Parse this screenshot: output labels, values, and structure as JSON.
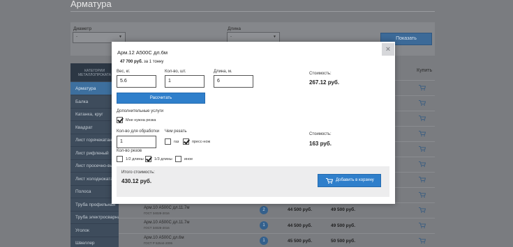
{
  "page": {
    "title": "Арматура"
  },
  "filters": {
    "diameter_label": "Диаметр",
    "diameter_value": "-",
    "length_label": "Длина",
    "length_value": "-",
    "show_button": "Показать"
  },
  "table": {
    "buy_header": "Купить"
  },
  "sidebar": {
    "header": "КАТЕГОРИИ МЕТАЛЛОПРОКАТА",
    "items": [
      {
        "label": "Арматура"
      },
      {
        "label": "Балка"
      },
      {
        "label": "Катанка, круг"
      },
      {
        "label": "Квадрат"
      },
      {
        "label": "Лист горячекатаный"
      },
      {
        "label": "Лист рифленый"
      },
      {
        "label": "Лист просечно-вытяжной"
      },
      {
        "label": "Лист холоднокатаный"
      },
      {
        "label": "Полоса"
      },
      {
        "label": "Труба профильная"
      },
      {
        "label": "Труба электросварная"
      },
      {
        "label": "Уголок"
      },
      {
        "label": "Швеллер"
      }
    ]
  },
  "product_rows": [
    {
      "name": "Арм.10 А500С дл.11.7м",
      "gost": "ГОСТ 34028-2016",
      "badge": "2",
      "price_ton": "44 500 руб.",
      "price2": "49 500 руб."
    },
    {
      "name": "Арм.10 А500С дл.11.7м",
      "gost": "ГОСТ 34028-2016",
      "badge": "1",
      "price_ton": "44 500 руб.",
      "price2": "49 500 руб."
    },
    {
      "name": "Арм.10 А500С дл.6м",
      "gost": "ГОСТ Р 52544-2006",
      "badge": "1",
      "price_ton": "45 500 руб.",
      "price2": "50 500 руб."
    }
  ],
  "modal": {
    "title": "Арм.12 А500С дл.6м",
    "price_bold": "47 700 руб.",
    "price_suffix": "за 1 тонну",
    "weight_label": "Вес, кг.",
    "weight_value": "5.6",
    "qty_label": "Кол-во, шт.",
    "qty_value": "1",
    "length_label": "Длина, м.",
    "length_value": "6",
    "cost_label": "Стоимость:",
    "cost_value": "267.12 руб.",
    "calc_button": "Рассчитать",
    "extra_label": "Дополнительные услуги",
    "cut_needed_label": "Мне нужна резка",
    "process_qty_label": "Кол-во для обработки",
    "process_qty_value": "1",
    "cut_with_label": "Чем резать",
    "gas_label": "газ",
    "press_label": "пресс-нож",
    "cut_cost_label": "Стоимость:",
    "cut_cost_value": "163 руб.",
    "cuts_label": "Кол-во резов",
    "half_label": "1/2 длины",
    "third_label": "1/3 длины",
    "other_label": "иное",
    "total_label": "Итого стоимость:",
    "total_value": "430.12 руб.",
    "add_button": "Добавить в корзину",
    "close_glyph": "×"
  },
  "colors": {
    "accent": "#2f7fcb",
    "sidebar_active": "#3d6f9e",
    "overlay": "#7a7c80"
  }
}
